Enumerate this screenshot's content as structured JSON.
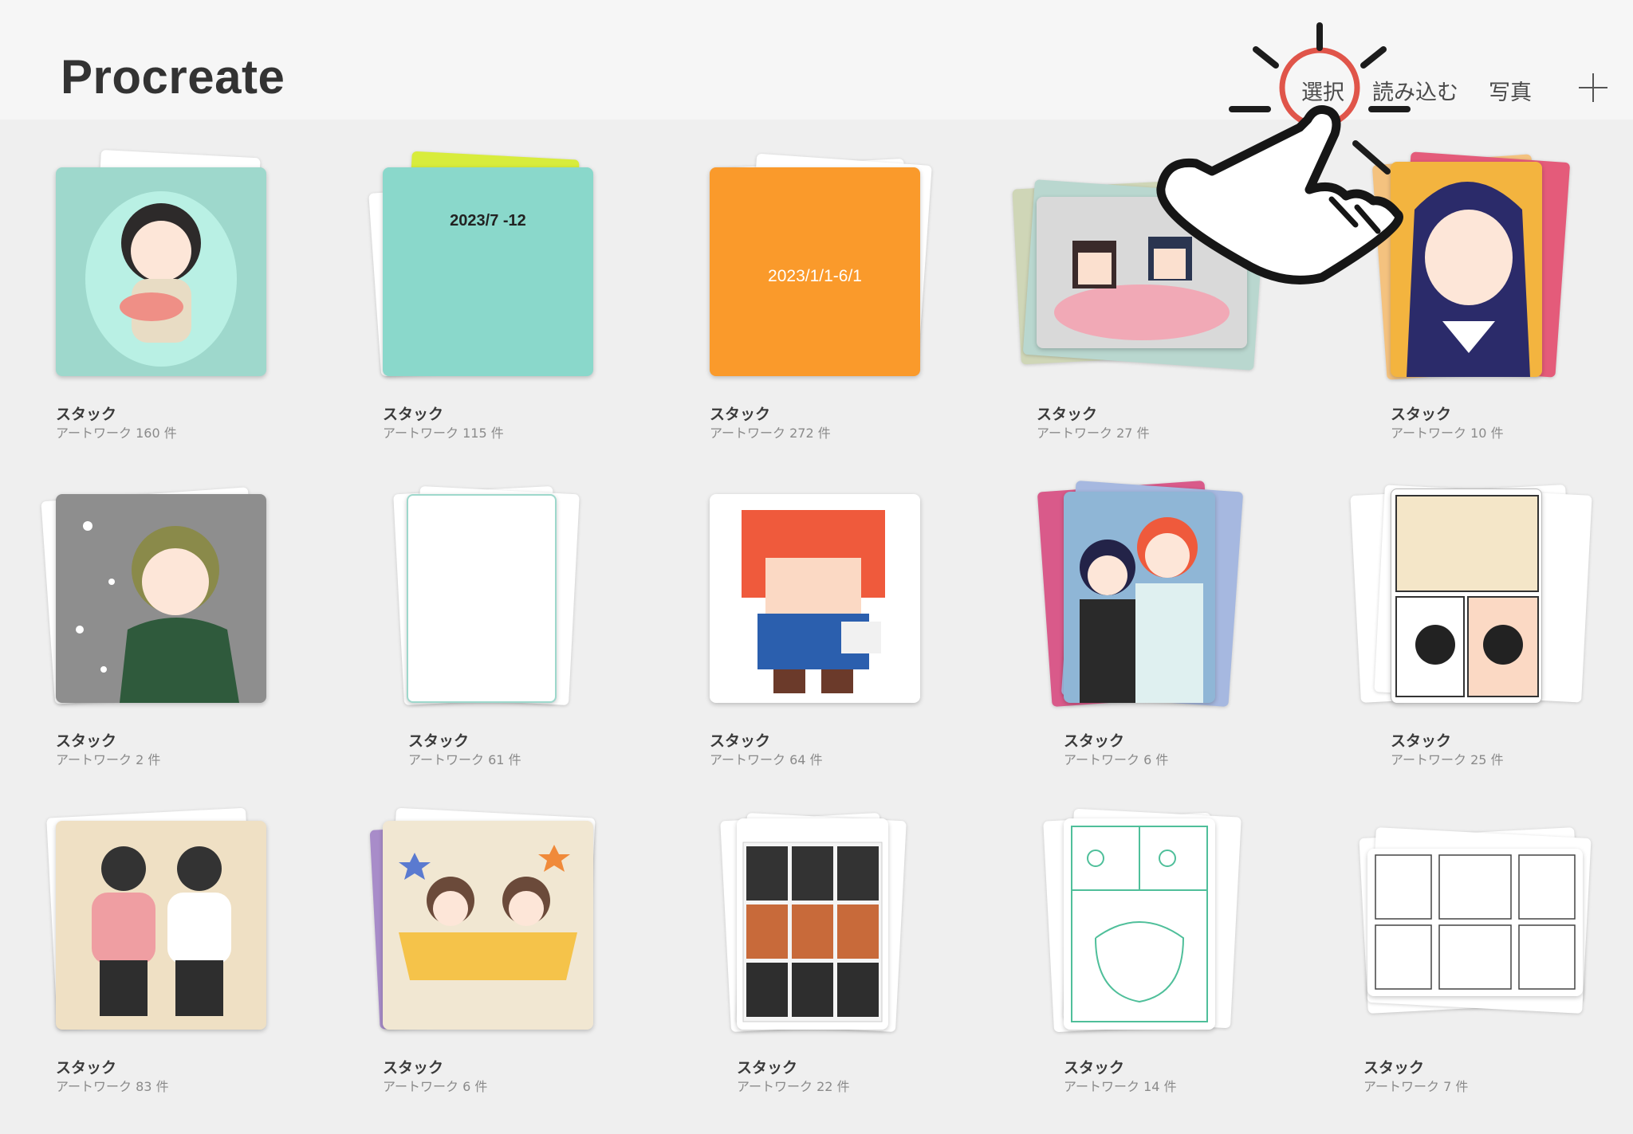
{
  "header": {
    "title": "Procreate",
    "actions": {
      "select": "選択",
      "import": "読み込む",
      "photos": "写真"
    },
    "add_icon": "plus-icon"
  },
  "gallery": {
    "stacks": [
      {
        "title": "スタック",
        "count": "アートワーク 160 件",
        "cover_color": "#9ed8cc"
      },
      {
        "title": "スタック",
        "count": "アートワーク 115 件",
        "cover_color": "#8ad8cb",
        "cover_text": "2023/7 -12"
      },
      {
        "title": "スタック",
        "count": "アートワーク 272 件",
        "cover_color": "#fa9a2b",
        "cover_text": "2023/1/1-6/1"
      },
      {
        "title": "スタック",
        "count": "アートワーク 27 件",
        "cover_color": "#d9d9d9"
      },
      {
        "title": "スタック",
        "count": "アートワーク 10 件",
        "cover_color": "#f3b43f"
      },
      {
        "title": "スタック",
        "count": "アートワーク 2 件",
        "cover_color": "#8e8e8e"
      },
      {
        "title": "スタック",
        "count": "アートワーク 61 件",
        "cover_color": "#ffffff"
      },
      {
        "title": "スタック",
        "count": "アートワーク 64 件",
        "cover_color": "#ffffff"
      },
      {
        "title": "スタック",
        "count": "アートワーク 6 件",
        "cover_color": "#8fb6d6"
      },
      {
        "title": "スタック",
        "count": "アートワーク 25 件",
        "cover_color": "#ffffff"
      },
      {
        "title": "スタック",
        "count": "アートワーク 83 件",
        "cover_color": "#efe0c4"
      },
      {
        "title": "スタック",
        "count": "アートワーク 6 件",
        "cover_color": "#f1e7d2"
      },
      {
        "title": "スタック",
        "count": "アートワーク 22 件",
        "cover_color": "#ffffff"
      },
      {
        "title": "スタック",
        "count": "アートワーク 14 件",
        "cover_color": "#ffffff"
      },
      {
        "title": "スタック",
        "count": "アートワーク 7 件",
        "cover_color": "#ffffff"
      }
    ]
  },
  "annotation": {
    "pointer_icon": "hand-pointer-icon",
    "highlight_color": "#e0554a"
  }
}
